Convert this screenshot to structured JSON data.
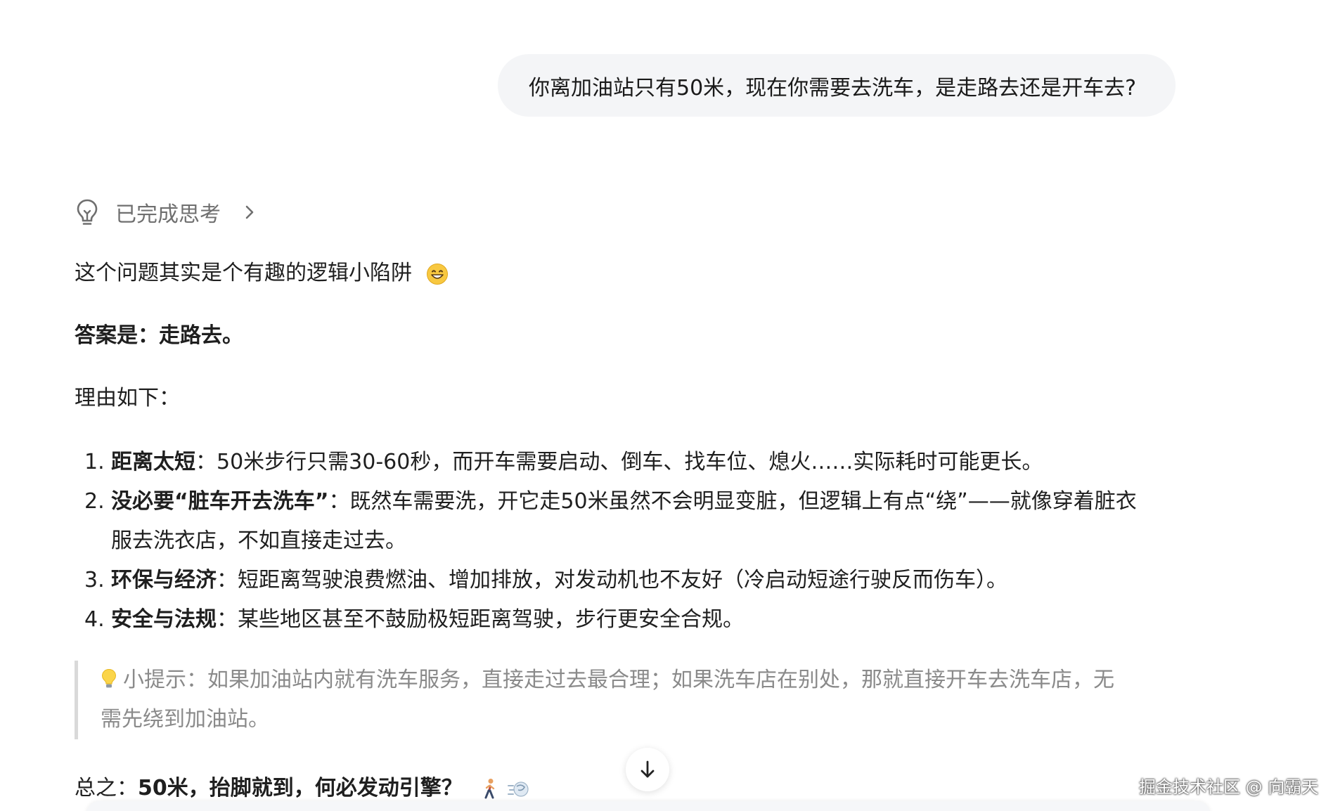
{
  "user_message": "你离加油站只有50米，现在你需要去洗车，是走路去还是开车去?",
  "thinking": {
    "label": "已完成思考",
    "icon": "lightbulb-icon",
    "expand_icon": "chevron-right-icon"
  },
  "answer": {
    "intro": "这个问题其实是个有趣的逻辑小陷阱",
    "intro_emoji": "grinning-face-emoji",
    "conclusion": "答案是：走路去。",
    "reasons_heading": "理由如下：",
    "reasons": [
      {
        "num": "1.",
        "title": "距离太短",
        "sep": "：",
        "text": "50米步行只需30-60秒，而开车需要启动、倒车、找车位、熄火……实际耗时可能更长。"
      },
      {
        "num": "2.",
        "title": "没必要“脏车开去洗车”",
        "sep": "：",
        "text": "既然车需要洗，开它走50米虽然不会明显变脏，但逻辑上有点“绕”——就像穿着脏衣",
        "text2": "服去洗衣店，不如直接走过去。"
      },
      {
        "num": "3.",
        "title": "环保与经济",
        "sep": "：",
        "text": "短距离驾驶浪费燃油、增加排放，对发动机也不友好（冷启动短途行驶反而伤车）。"
      },
      {
        "num": "4.",
        "title": "安全与法规",
        "sep": "：",
        "text": "某些地区甚至不鼓励极短距离驾驶，步行更安全合规。"
      }
    ],
    "tip": {
      "icon": "lightbulb-emoji",
      "line1": "小提示：如果加油站内就有洗车服务，直接走过去最合理；如果洗车店在别处，那就直接开车去洗车店，无",
      "line2": "需先绕到加油站。"
    },
    "summary_prefix": "总之：",
    "summary_bold": "50米，抬脚就到，何必发动引擎？",
    "summary_emojis": [
      "walking-person-emoji",
      "dash-emoji"
    ]
  },
  "scroll_button": {
    "icon": "arrow-down-icon"
  },
  "watermark": "掘金技术社区 @ 向霸天"
}
